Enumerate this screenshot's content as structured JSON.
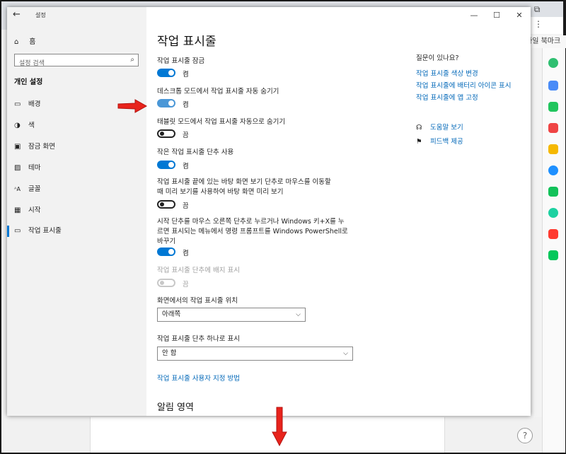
{
  "window": {
    "title": "설정",
    "back_icon": "←",
    "controls": [
      "—",
      "☐",
      "✕"
    ]
  },
  "browser": {
    "tab_icons": [
      "⧉",
      "⊡",
      "✕"
    ],
    "more": "⋮",
    "bookmark_text": "파일 북마크",
    "help": "?"
  },
  "sidebar": {
    "home": {
      "icon": "⌂",
      "label": "홈"
    },
    "search": {
      "placeholder": "설정 검색",
      "icon": "⌕"
    },
    "section_title": "개인 설정",
    "items": [
      {
        "icon": "▭",
        "label": "배경"
      },
      {
        "icon": "◑",
        "label": "색"
      },
      {
        "icon": "▣",
        "label": "잠금 화면"
      },
      {
        "icon": "▨",
        "label": "테마"
      },
      {
        "icon": "ᴬA",
        "label": "글꼴"
      },
      {
        "icon": "▦",
        "label": "시작"
      },
      {
        "icon": "▭",
        "label": "작업 표시줄"
      }
    ],
    "active_index": 6
  },
  "main": {
    "title": "작업 표시줄",
    "settings": [
      {
        "label": "작업 표시줄 잠금",
        "state": "켬",
        "on": true
      },
      {
        "label": "데스크톱 모드에서 작업 표시줄 자동 숨기기",
        "state": "켬",
        "on": true
      },
      {
        "label": "태블릿 모드에서 작업 표시줄 자동으로 숨기기",
        "state": "끔",
        "on": false
      },
      {
        "label": "작은 작업 표시줄 단추 사용",
        "state": "켬",
        "on": true
      },
      {
        "label_lines": [
          "작업 표시줄 끝에 있는 바탕 화면 보기 단추로 마우스를 이동할",
          "때 미리 보기를 사용하여 바탕 화면 미리 보기"
        ],
        "state": "끔",
        "on": false
      },
      {
        "label_lines": [
          "시작 단추를 마우스 오른쪽 단추로 누르거나 Windows 키+X를 누",
          "르면 표시되는 메뉴에서 명령 프롬프트를 Windows PowerShell로",
          "바꾸기"
        ],
        "state": "켬",
        "on": true
      },
      {
        "label": "작업 표시줄 단추에 배지 표시",
        "state": "끔",
        "on": false,
        "disabled": true
      }
    ],
    "position": {
      "label": "화면에서의 작업 표시줄 위치",
      "value": "아래쪽"
    },
    "combine": {
      "label": "작업 표시줄 단추 하나로 표시",
      "value": "안 함"
    },
    "chevron": "⌵",
    "custom_link": "작업 표시줄 사용자 지정 방법",
    "notification_title": "알림 영역"
  },
  "right": {
    "question": "질문이 있나요?",
    "links": [
      "작업 표시줄 색상 변경",
      "작업 표시줄에 배터리 아이콘 표시",
      "작업 표시줄에 앱 고정"
    ],
    "help": {
      "icon": "☊",
      "label": "도움말 보기"
    },
    "feedback": {
      "icon": "⚑",
      "label": "피드백 제공"
    }
  },
  "colors": {
    "accent": "#0078d4",
    "link": "#0067b8",
    "arrow": "#e8231c"
  }
}
